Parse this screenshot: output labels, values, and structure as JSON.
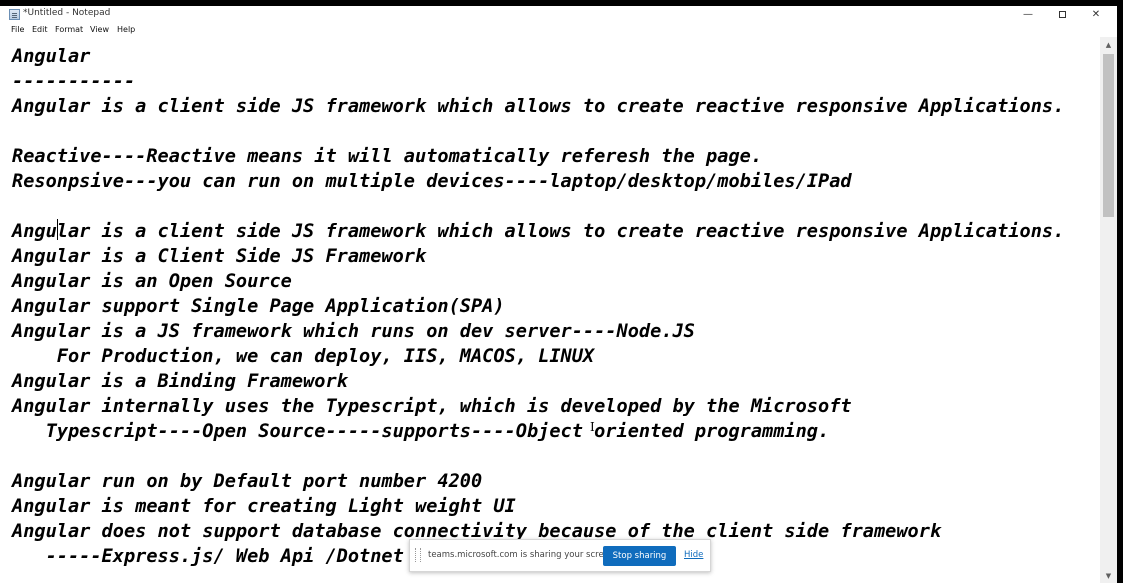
{
  "window": {
    "title": "*Untitled - Notepad",
    "minimize_icon": "minimize-icon",
    "maximize_icon": "maximize-icon",
    "close_icon": "close-icon"
  },
  "menu": [
    "File",
    "Edit",
    "Format",
    "View",
    "Help"
  ],
  "editor": {
    "lines": [
      "Angular",
      "-----------",
      "Angular is a client side JS framework which allows to create reactive responsive Applications.",
      "",
      "Reactive----Reactive means it will automatically referesh the page.",
      "Resonpsive---you can run on multiple devices----laptop/desktop/mobiles/IPad",
      "",
      "Angular is a client side JS framework which allows to create reactive responsive Applications.",
      "Angular is a Client Side JS Framework",
      "Angular is an Open Source",
      "Angular support Single Page Application(SPA)",
      "Angular is a JS framework which runs on dev server----Node.JS",
      "    For Production, we can deploy, IIS, MACOS, LINUX",
      "Angular is a Binding Framework",
      "Angular internally uses the Typescript, which is developed by the Microsoft",
      "   Typescript----Open Source-----supports----Object oriented programming.",
      "",
      "Angular run on by Default port number 4200",
      "Angular is meant for creating Light weight UI",
      "Angular does not support database connectivity because of the client side framework",
      "   -----Express.js/ Web Api /Dotnet Core Web API"
    ]
  },
  "share_bar": {
    "message": "teams.microsoft.com is sharing your screen.",
    "stop_label": "Stop sharing",
    "hide_label": "Hide"
  }
}
